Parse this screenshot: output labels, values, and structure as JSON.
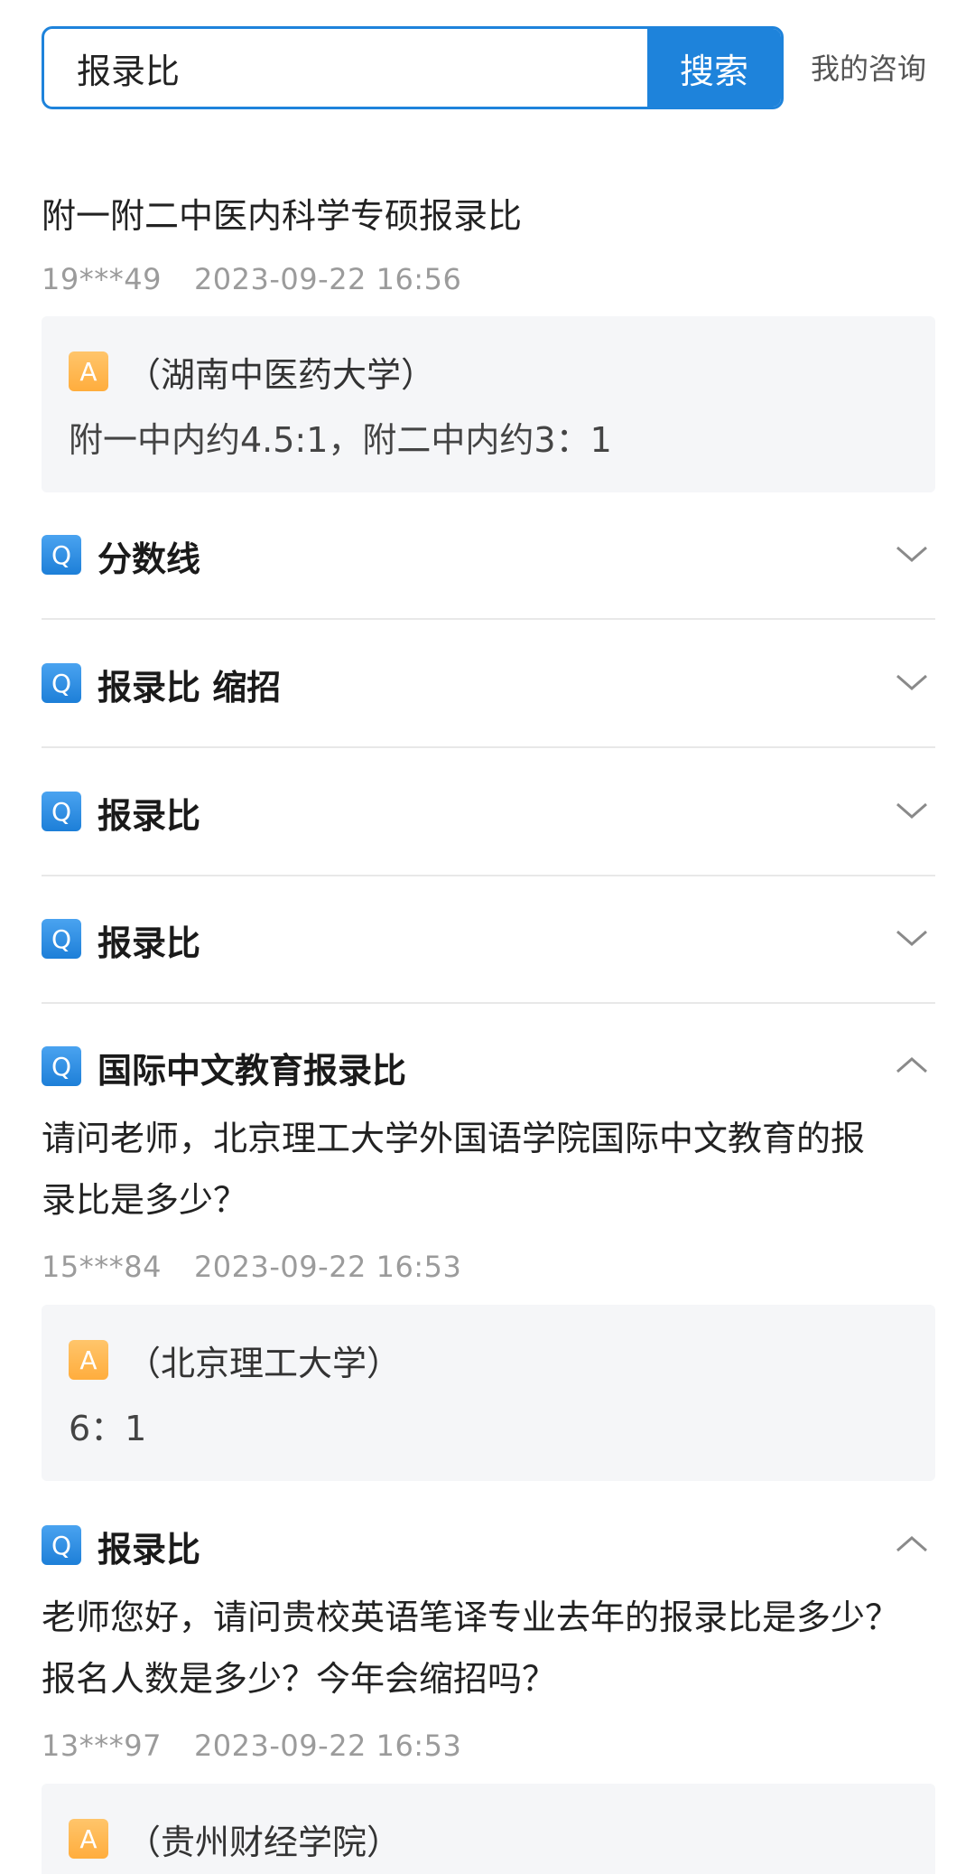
{
  "search": {
    "value": "报录比",
    "button_label": "搜索"
  },
  "header": {
    "my_consult": "我的咨询"
  },
  "first_item": {
    "title": "附一附二中医内科学专硕报录比",
    "user": "19***49",
    "time": "2023-09-22 16:56",
    "answer_school": "（湖南中医药大学）",
    "answer_text": "附一中内约4.5:1，附二中内约3：1"
  },
  "collapsed": [
    {
      "label": "分数线"
    },
    {
      "label": "报录比 缩招"
    },
    {
      "label": "报录比"
    },
    {
      "label": "报录比"
    }
  ],
  "expanded": [
    {
      "label": "国际中文教育报录比",
      "question": [
        "请问老师，北京理工大学外国语学院国际中文教育的报",
        "录比是多少？"
      ],
      "user": "15***84",
      "time": "2023-09-22 16:53",
      "answer_school": "（北京理工大学）",
      "answer_text": "6：1"
    },
    {
      "label": "报录比",
      "question": [
        "老师您好，请问贵校英语笔译专业去年的报录比是多少？",
        "报名人数是多少？今年会缩招吗？"
      ],
      "user": "13***97",
      "time": "2023-09-22 16:53",
      "answer_school": "（贵州财经学院）"
    }
  ],
  "icons": {
    "question": "Q",
    "answer": "A"
  },
  "colors": {
    "accent": "#1e83db",
    "answer_icon": "#ffad3d"
  }
}
